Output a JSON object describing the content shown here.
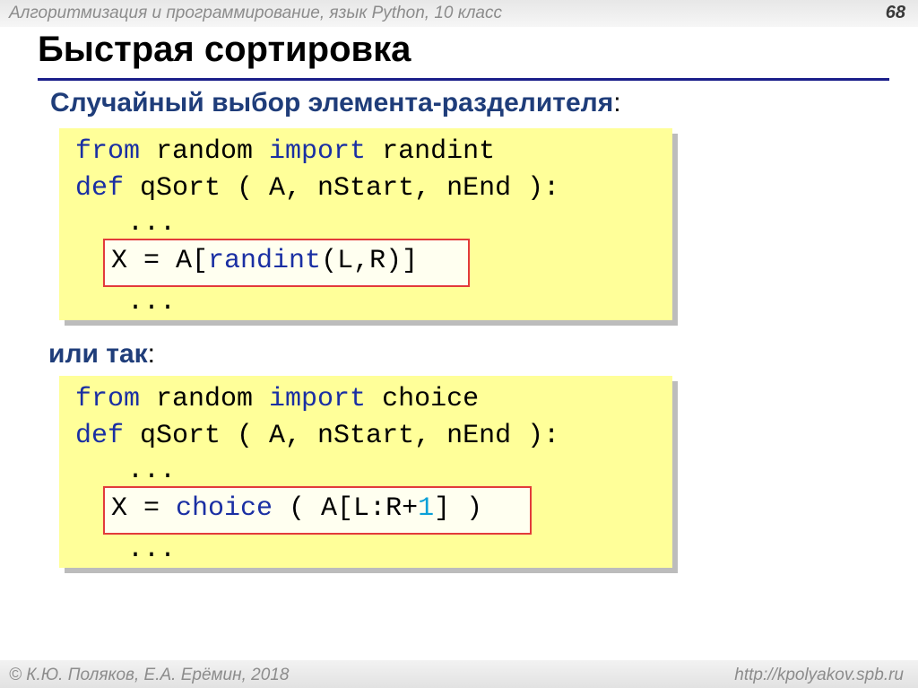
{
  "header": {
    "course": "Алгоритмизация и программирование, язык Python, 10 класс",
    "page_number": "68"
  },
  "title": "Быстрая сортировка",
  "subtitle": "Случайный выбор элемента-разделителя",
  "subtitle_colon": ":",
  "code1": {
    "line1": {
      "kw1": "from",
      "t1": " random ",
      "kw2": "import",
      "t2": " randint"
    },
    "line2": {
      "kw1": "def",
      "t1": " qSort ( A, nStart, nEnd ):"
    },
    "line3": "  ...",
    "line4": {
      "t1": "X = A[",
      "kw1": "randint",
      "t2": "(L,R)]"
    },
    "line5": "  ..."
  },
  "or_label": "или так",
  "or_colon": ":",
  "code2": {
    "line1": {
      "kw1": "from",
      "t1": " random ",
      "kw2": "import",
      "t2": " choice"
    },
    "line2": {
      "kw1": "def",
      "t1": " qSort ( A, nStart, nEnd ):"
    },
    "line3": "  ...",
    "line4": {
      "t1": "X = ",
      "kw1": "choice",
      "t2": " ( A[L:R+",
      "num": "1",
      "t3": "] )"
    },
    "line5": "  ..."
  },
  "footer": {
    "authors": "© К.Ю. Поляков, Е.А. Ерёмин, 2018",
    "url": "http://kpolyakov.spb.ru"
  },
  "colors": {
    "keyword": "#1a2fa3",
    "number": "#0aa0d8",
    "code_bg": "#ffff99",
    "highlight_border": "#e23b3b",
    "title_rule": "#1b1f8a"
  }
}
